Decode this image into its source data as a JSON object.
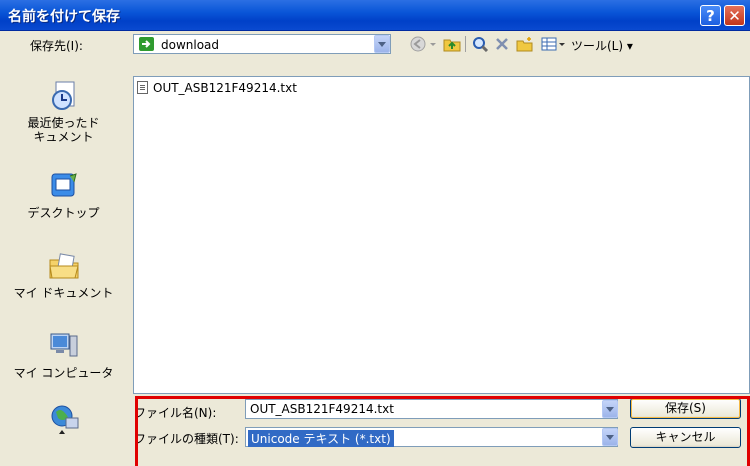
{
  "window": {
    "title": "名前を付けて保存"
  },
  "save_in": {
    "label": "保存先(I):",
    "value": "download"
  },
  "toolbar": {
    "tools_label": "ツール(L)"
  },
  "places": [
    {
      "label": "最近使ったド\nキュメント"
    },
    {
      "label": "デスクトップ"
    },
    {
      "label": "マイ ドキュメント"
    },
    {
      "label": "マイ コンピュータ"
    }
  ],
  "files": [
    {
      "name": "OUT_ASB121F49214.txt"
    }
  ],
  "filename": {
    "label": "ファイル名(N):",
    "value": "OUT_ASB121F49214.txt"
  },
  "filetype": {
    "label": "ファイルの種類(T):",
    "value": "Unicode テキスト (*.txt)"
  },
  "buttons": {
    "save": "保存(S)",
    "cancel": "キャンセル"
  },
  "colors": {
    "titlebar": "#0a56d8",
    "highlight": "#e00000",
    "selection": "#316ac5"
  }
}
